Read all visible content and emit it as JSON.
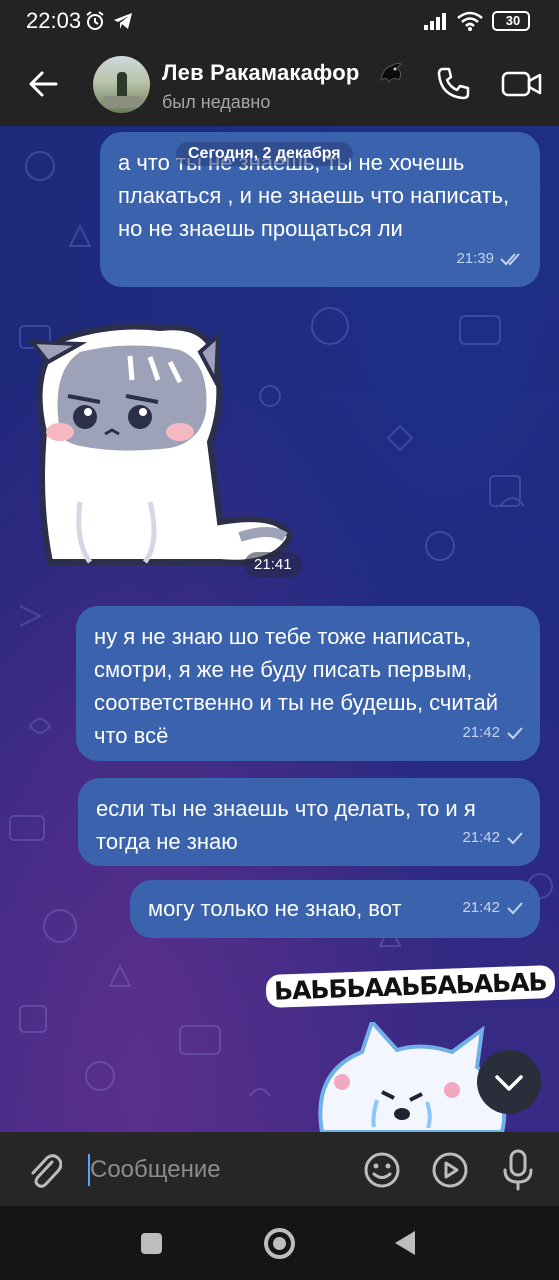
{
  "status_bar": {
    "time": "22:03",
    "battery": "30"
  },
  "header": {
    "name": "Лев Ракамакафор",
    "status": "был недавно"
  },
  "chat": {
    "date": "Сегодня, 2 декабря",
    "messages": [
      {
        "text": "а что ты не знаешь, ты не хочешь плакаться , и не знаешь что написать, но не знаешь прощаться ли",
        "time": "21:39",
        "read": true
      },
      {
        "sticker": "sad-cat-sticker",
        "time": "21:41"
      },
      {
        "text": "ну я не знаю шо тебе тоже написать, смотри, я же не буду писать первым, соответственно и ты не будешь, считай что всё",
        "time": "21:42",
        "read": false
      },
      {
        "text": "если ты не знаешь что делать, то и я тогда не знаю",
        "time": "21:42",
        "read": false
      },
      {
        "text": "могу только не знаю, вот",
        "time": "21:42",
        "read": false
      },
      {
        "sticker": "crying-creature-sticker",
        "caption": "ЬАЬБЬААЬБАЬАЬАЬ"
      }
    ]
  },
  "input": {
    "placeholder": "Сообщение",
    "value": ""
  },
  "colors": {
    "bubble": "#3a62ad",
    "header": "#232323",
    "accent": "#5aa0ff"
  }
}
